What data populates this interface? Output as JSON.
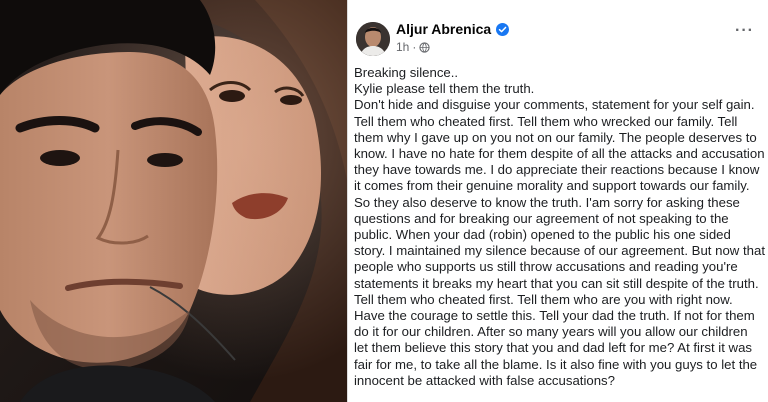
{
  "post": {
    "author": "Aljur Abrenica",
    "time": "1h",
    "separator": "·",
    "more_label": "···",
    "lines": [
      "Breaking silence..",
      "Kylie please tell them the truth.",
      "Don't hide and disguise your comments, statement for your self gain.",
      "Tell them who cheated first. Tell them who wrecked our family. Tell",
      "them why I gave up on you not on our family. The people deserves to",
      "know. I have no hate for them despite of all the attacks and accusation",
      "they have towards me. I do appreciate their reactions because I know",
      "it comes from their genuine morality and support towards our family.",
      "So they also deserve to know the truth. I'am sorry for asking these",
      "questions and for breaking our agreement of not speaking to the",
      "public. When your dad (robin) opened to the public his one sided",
      "story. I maintained my silence because of our agreement. But now that",
      "people who supports us still throw accusations and reading you're",
      "statements it breaks my heart that you can sit still despite of the truth.",
      "Tell them who cheated first. Tell them who are you with right now.",
      "Have the courage to settle this. Tell your dad the truth. If not for them",
      "do it for our children. After so many years will you allow our children",
      "let them believe this story that you and dad left for me? At first it was",
      "fair for me, to take all the blame. Is it also fine with you guys to let the",
      "innocent be attacked with false accusations?"
    ]
  },
  "colors": {
    "verified": "#1877f2",
    "text": "#1c1e21",
    "meta": "#65676b"
  },
  "icons": {
    "verified": "verified-badge-icon",
    "audience": "globe-icon",
    "menu": "more-options-icon"
  }
}
